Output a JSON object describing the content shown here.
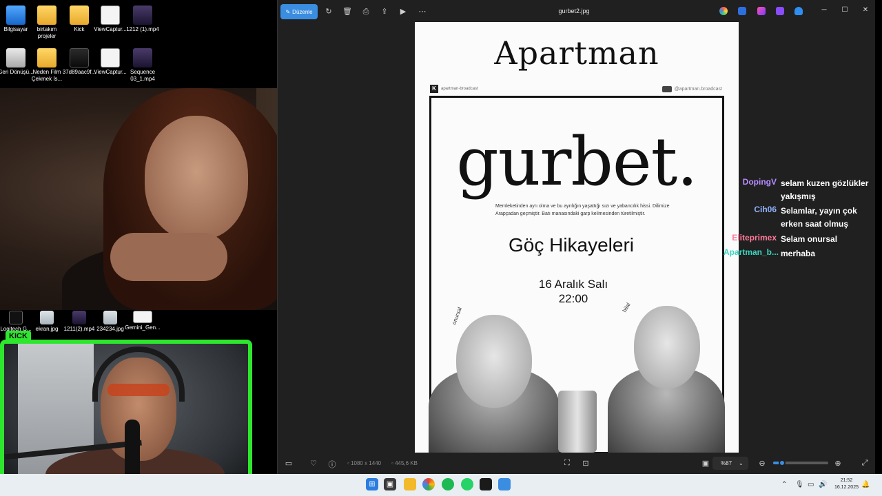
{
  "desktop": {
    "icons_row1": [
      {
        "label": "Bilgisayar",
        "icon": "computer-icon"
      },
      {
        "label": "birtakım projeler",
        "icon": "folder-icon"
      },
      {
        "label": "Kick",
        "icon": "folder-icon"
      },
      {
        "label": "ViewCaptur...",
        "icon": "image-file-icon"
      },
      {
        "label": "1212 (1).mp4",
        "icon": "video-file-icon"
      }
    ],
    "icons_row2": [
      {
        "label": "Geri Dönüşü...",
        "icon": "recycle-bin-icon"
      },
      {
        "label": "Neden Film Çekmek İs...",
        "icon": "folder-icon"
      },
      {
        "label": "37d89aac9f...",
        "icon": "file-icon"
      },
      {
        "label": "ViewCaptur...",
        "icon": "image-file-icon"
      },
      {
        "label": "Sequence 03_1.mp4",
        "icon": "video-file-icon"
      }
    ],
    "icons_row3": [
      {
        "label": "Logitech G...",
        "icon": "logitech-icon"
      },
      {
        "label": "ekran.jpg",
        "icon": "image-file-icon"
      },
      {
        "label": "1211(2).mp4",
        "icon": "video-file-icon"
      },
      {
        "label": "234234.jpg",
        "icon": "image-file-icon"
      },
      {
        "label": "Gemini_Gen...",
        "icon": "image-file-icon"
      }
    ]
  },
  "stream_overlay": {
    "kick_label": "KICK"
  },
  "photos_app": {
    "edit_label": "Düzenle",
    "title": "gurbet2.jpg",
    "dimensions": "1080 x 1440",
    "file_size": "445,6 KB",
    "zoom": "%87",
    "zoom_level": 0.16
  },
  "poster": {
    "top_title": "Apartman",
    "brand_left": "apartman-broadcast",
    "brand_right": "@apartman.broadcast",
    "headline": "gurbet.",
    "description": "Memleketinden ayrı olma ve bu ayrılığın yaşattığı sızı ve yabancılık hissi. Dilimize Arapçadan geçmiştir. Batı manasındaki garp kelimesinden türetilmiştir.",
    "subtitle": "Göç Hikayeleri",
    "date": "16 Aralık Salı",
    "time": "22:00",
    "name_left": "onursal",
    "name_right": "hilal"
  },
  "chat": [
    {
      "user": "DopingV",
      "color": "#b68cff",
      "message": "selam kuzen gözlükler yakışmış"
    },
    {
      "user": "Cih06",
      "color": "#8fb3ff",
      "message": "Selamlar, yayın çok erken saat olmuş"
    },
    {
      "user": "Eliteprimex",
      "color": "#ff7a9a",
      "message": "Selam onursal"
    },
    {
      "user": "Apartman_b...",
      "color": "#39d6c0",
      "message": "merhaba"
    }
  ],
  "taskbar": {
    "time": "21:52",
    "date": "16.12.2025"
  }
}
